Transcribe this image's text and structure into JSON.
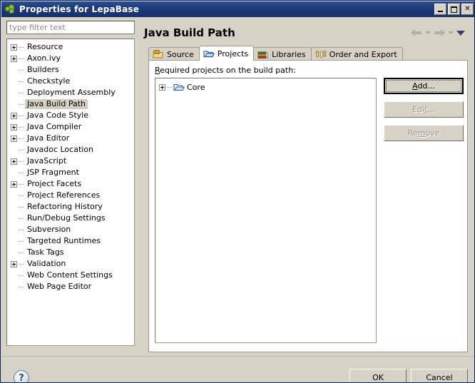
{
  "window": {
    "title": "Properties for LepaBase",
    "icon": "ivy-leaf-icon",
    "buttons": {
      "minimize": "minimize-button",
      "maximize": "maximize-button",
      "close": "close-button",
      "close_glyph": "✕"
    }
  },
  "sidebar": {
    "filter": {
      "placeholder": "type filter text",
      "value": ""
    },
    "items": [
      {
        "label": "Resource",
        "expandable": true,
        "selected": false
      },
      {
        "label": "Axon.ivy",
        "expandable": true,
        "selected": false
      },
      {
        "label": "Builders",
        "expandable": false,
        "selected": false
      },
      {
        "label": "Checkstyle",
        "expandable": false,
        "selected": false
      },
      {
        "label": "Deployment Assembly",
        "expandable": false,
        "selected": false
      },
      {
        "label": "Java Build Path",
        "expandable": false,
        "selected": true
      },
      {
        "label": "Java Code Style",
        "expandable": true,
        "selected": false
      },
      {
        "label": "Java Compiler",
        "expandable": true,
        "selected": false
      },
      {
        "label": "Java Editor",
        "expandable": true,
        "selected": false
      },
      {
        "label": "Javadoc Location",
        "expandable": false,
        "selected": false
      },
      {
        "label": "JavaScript",
        "expandable": true,
        "selected": false
      },
      {
        "label": "JSP Fragment",
        "expandable": false,
        "selected": false
      },
      {
        "label": "Project Facets",
        "expandable": true,
        "selected": false
      },
      {
        "label": "Project References",
        "expandable": false,
        "selected": false
      },
      {
        "label": "Refactoring History",
        "expandable": false,
        "selected": false
      },
      {
        "label": "Run/Debug Settings",
        "expandable": false,
        "selected": false
      },
      {
        "label": "Subversion",
        "expandable": false,
        "selected": false
      },
      {
        "label": "Targeted Runtimes",
        "expandable": false,
        "selected": false
      },
      {
        "label": "Task Tags",
        "expandable": false,
        "selected": false
      },
      {
        "label": "Validation",
        "expandable": true,
        "selected": false
      },
      {
        "label": "Web Content Settings",
        "expandable": false,
        "selected": false
      },
      {
        "label": "Web Page Editor",
        "expandable": false,
        "selected": false
      }
    ]
  },
  "page": {
    "title": "Java Build Path",
    "nav": {
      "back": "back-arrow",
      "back_menu": "back-history-caret",
      "forward": "forward-arrow",
      "forward_menu": "forward-history-caret",
      "menu": "view-menu-caret"
    },
    "tabs": [
      {
        "label": "Source",
        "icon": "source-folder-icon",
        "active": false
      },
      {
        "label": "Projects",
        "icon": "projects-folder-icon",
        "active": true
      },
      {
        "label": "Libraries",
        "icon": "libraries-books-icon",
        "active": false
      },
      {
        "label": "Order and Export",
        "icon": "order-export-arrows-icon",
        "active": false
      }
    ],
    "projects_tab": {
      "list_label": "Required projects on the build path:",
      "list_label_mnemonic": "R",
      "projects": [
        {
          "name": "Core",
          "expandable": true,
          "icon": "project-folder-icon"
        }
      ],
      "buttons": [
        {
          "label": "Add...",
          "mnemonic": "A",
          "enabled": true,
          "focused": true
        },
        {
          "label": "Edit...",
          "mnemonic": "t",
          "enabled": false,
          "focused": false
        },
        {
          "label": "Remove",
          "mnemonic": "m",
          "enabled": false,
          "focused": false
        }
      ]
    }
  },
  "footer": {
    "help": "?",
    "ok": "OK",
    "cancel": "Cancel"
  },
  "colors": {
    "title_bar": "#1c3a78",
    "dialog_bg": "#d6d2c6",
    "selection": "#d2cec2",
    "accent": "#2c4a76"
  }
}
